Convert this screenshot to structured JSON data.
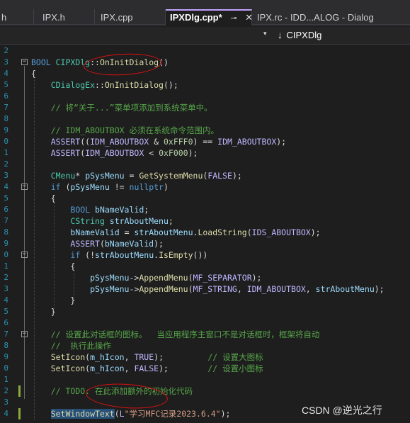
{
  "tabs": [
    {
      "label": "h",
      "active": false
    },
    {
      "label": "IPX.h",
      "active": false
    },
    {
      "label": "IPX.cpp",
      "active": false
    },
    {
      "label": "IPXDlg.cpp*",
      "active": true,
      "pin": "⊸",
      "close": "✕"
    },
    {
      "label": "IPX.rc - IDD...ALOG - Dialog",
      "active": false
    }
  ],
  "nav": {
    "dropdown": "▾",
    "arrow": "↓",
    "member": "CIPXDlg"
  },
  "line_numbers": [
    "2",
    "3",
    "4",
    "5",
    "6",
    "7",
    "8",
    "9",
    "0",
    "1",
    "2",
    "3",
    "4",
    "5",
    "6",
    "7",
    "8",
    "9",
    "0",
    "1",
    "2",
    "3",
    "4",
    "5",
    "6",
    "7",
    "8",
    "9",
    "0",
    "1",
    "2",
    "3",
    "4"
  ],
  "watermark": "CSDN @逆光之行",
  "colors": {
    "keyword": "#569cd6",
    "type": "#4ec9b0",
    "function": "#dcdcaa",
    "macro": "#beb7ff",
    "string": "#d69d85",
    "comment": "#57a64a",
    "number": "#b5cea8",
    "annotation": "#e01010"
  },
  "code_lines": [
    [],
    [
      [
        "kw",
        "BOOL "
      ],
      [
        "ty",
        "CIPXDlg"
      ],
      [
        "pl",
        "::"
      ],
      [
        "fn",
        "OnInitDialog"
      ],
      [
        "pl",
        "()"
      ]
    ],
    [
      [
        "pl",
        "{"
      ]
    ],
    [
      [
        "pl",
        "    "
      ],
      [
        "ty",
        "CDialogEx"
      ],
      [
        "pl",
        "::"
      ],
      [
        "fn",
        "OnInitDialog"
      ],
      [
        "pl",
        "();"
      ]
    ],
    [],
    [
      [
        "pl",
        "    "
      ],
      [
        "cm",
        "// 将“关于...”菜单项添加到系统菜单中。"
      ]
    ],
    [],
    [
      [
        "pl",
        "    "
      ],
      [
        "cm",
        "// IDM_ABOUTBOX 必须在系统命令范围内。"
      ]
    ],
    [
      [
        "pl",
        "    "
      ],
      [
        "mac",
        "ASSERT"
      ],
      [
        "pl",
        "(("
      ],
      [
        "mac",
        "IDM_ABOUTBOX"
      ],
      [
        "pl",
        " & "
      ],
      [
        "num",
        "0xFFF0"
      ],
      [
        "pl",
        ") == "
      ],
      [
        "mac",
        "IDM_ABOUTBOX"
      ],
      [
        "pl",
        ");"
      ]
    ],
    [
      [
        "pl",
        "    "
      ],
      [
        "mac",
        "ASSERT"
      ],
      [
        "pl",
        "("
      ],
      [
        "mac",
        "IDM_ABOUTBOX"
      ],
      [
        "pl",
        " < "
      ],
      [
        "num",
        "0xF000"
      ],
      [
        "pl",
        ");"
      ]
    ],
    [],
    [
      [
        "pl",
        "    "
      ],
      [
        "ty",
        "CMenu"
      ],
      [
        "pl",
        "* "
      ],
      [
        "var",
        "pSysMenu"
      ],
      [
        "pl",
        " = "
      ],
      [
        "fn",
        "GetSystemMenu"
      ],
      [
        "pl",
        "("
      ],
      [
        "mac",
        "FALSE"
      ],
      [
        "pl",
        ");"
      ]
    ],
    [
      [
        "pl",
        "    "
      ],
      [
        "kw",
        "if"
      ],
      [
        "pl",
        " ("
      ],
      [
        "var",
        "pSysMenu"
      ],
      [
        "pl",
        " != "
      ],
      [
        "kw",
        "nullptr"
      ],
      [
        "pl",
        ")"
      ]
    ],
    [
      [
        "pl",
        "    {"
      ]
    ],
    [
      [
        "pl",
        "        "
      ],
      [
        "kw",
        "BOOL "
      ],
      [
        "var",
        "bNameValid"
      ],
      [
        "pl",
        ";"
      ]
    ],
    [
      [
        "pl",
        "        "
      ],
      [
        "ty",
        "CString "
      ],
      [
        "var",
        "strAboutMenu"
      ],
      [
        "pl",
        ";"
      ]
    ],
    [
      [
        "pl",
        "        "
      ],
      [
        "var",
        "bNameValid"
      ],
      [
        "pl",
        " = "
      ],
      [
        "var",
        "strAboutMenu"
      ],
      [
        "pl",
        "."
      ],
      [
        "fn",
        "LoadString"
      ],
      [
        "pl",
        "("
      ],
      [
        "mac",
        "IDS_ABOUTBOX"
      ],
      [
        "pl",
        ");"
      ]
    ],
    [
      [
        "pl",
        "        "
      ],
      [
        "mac",
        "ASSERT"
      ],
      [
        "pl",
        "("
      ],
      [
        "var",
        "bNameValid"
      ],
      [
        "pl",
        ");"
      ]
    ],
    [
      [
        "pl",
        "        "
      ],
      [
        "kw",
        "if"
      ],
      [
        "pl",
        " (!"
      ],
      [
        "var",
        "strAboutMenu"
      ],
      [
        "pl",
        "."
      ],
      [
        "fn",
        "IsEmpty"
      ],
      [
        "pl",
        "())"
      ]
    ],
    [
      [
        "pl",
        "        {"
      ]
    ],
    [
      [
        "pl",
        "            "
      ],
      [
        "var",
        "pSysMenu"
      ],
      [
        "pl",
        "->"
      ],
      [
        "fn",
        "AppendMenu"
      ],
      [
        "pl",
        "("
      ],
      [
        "mac",
        "MF_SEPARATOR"
      ],
      [
        "pl",
        ");"
      ]
    ],
    [
      [
        "pl",
        "            "
      ],
      [
        "var",
        "pSysMenu"
      ],
      [
        "pl",
        "->"
      ],
      [
        "fn",
        "AppendMenu"
      ],
      [
        "pl",
        "("
      ],
      [
        "mac",
        "MF_STRING"
      ],
      [
        "pl",
        ", "
      ],
      [
        "mac",
        "IDM_ABOUTBOX"
      ],
      [
        "pl",
        ", "
      ],
      [
        "var",
        "strAboutMenu"
      ],
      [
        "pl",
        ");"
      ]
    ],
    [
      [
        "pl",
        "        }"
      ]
    ],
    [
      [
        "pl",
        "    }"
      ]
    ],
    [],
    [
      [
        "pl",
        "    "
      ],
      [
        "cm",
        "// 设置此对话框的图标。  当应用程序主窗口不是对话框时，框架将自动"
      ]
    ],
    [
      [
        "pl",
        "    "
      ],
      [
        "cm",
        "//  执行此操作"
      ]
    ],
    [
      [
        "pl",
        "    "
      ],
      [
        "fn",
        "SetIcon"
      ],
      [
        "pl",
        "("
      ],
      [
        "var",
        "m_hIcon"
      ],
      [
        "pl",
        ", "
      ],
      [
        "mac",
        "TRUE"
      ],
      [
        "pl",
        ");         "
      ],
      [
        "cm",
        "// 设置大图标"
      ]
    ],
    [
      [
        "pl",
        "    "
      ],
      [
        "fn",
        "SetIcon"
      ],
      [
        "pl",
        "("
      ],
      [
        "var",
        "m_hIcon"
      ],
      [
        "pl",
        ", "
      ],
      [
        "mac",
        "FALSE"
      ],
      [
        "pl",
        ");        "
      ],
      [
        "cm",
        "// 设置小图标"
      ]
    ],
    [],
    [
      [
        "pl",
        "    "
      ],
      [
        "cm",
        "// TODO: 在此添加额外的初始化代码"
      ]
    ],
    [],
    [
      [
        "pl",
        "    "
      ],
      [
        "fn",
        "SetWindowText"
      ],
      [
        "pl",
        "("
      ],
      [
        "mac",
        "L"
      ],
      [
        "str",
        "\"学习MFC记录2023.6.4\""
      ],
      [
        "pl",
        ");"
      ]
    ]
  ]
}
